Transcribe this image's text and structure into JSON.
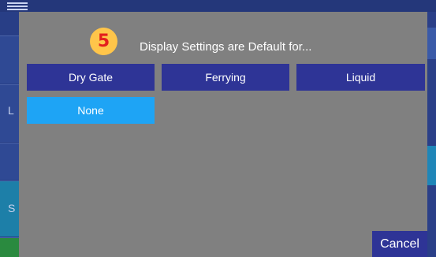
{
  "background": {
    "left_letters": [
      "L",
      "S"
    ]
  },
  "modal": {
    "step_number": "5",
    "title": "Display Settings are Default for...",
    "options": [
      {
        "label": "Dry Gate",
        "selected": false
      },
      {
        "label": "Ferrying",
        "selected": false
      },
      {
        "label": "Liquid",
        "selected": false
      },
      {
        "label": "None",
        "selected": true
      }
    ],
    "cancel_label": "Cancel"
  },
  "colors": {
    "modal_background": "#808080",
    "option_button": "#2e3496",
    "option_selected": "#1ea4f5",
    "badge_fill": "#ffc54a",
    "badge_text": "#e41e1e",
    "app_background": "#24377a"
  },
  "icons": [
    "menu-icon"
  ]
}
